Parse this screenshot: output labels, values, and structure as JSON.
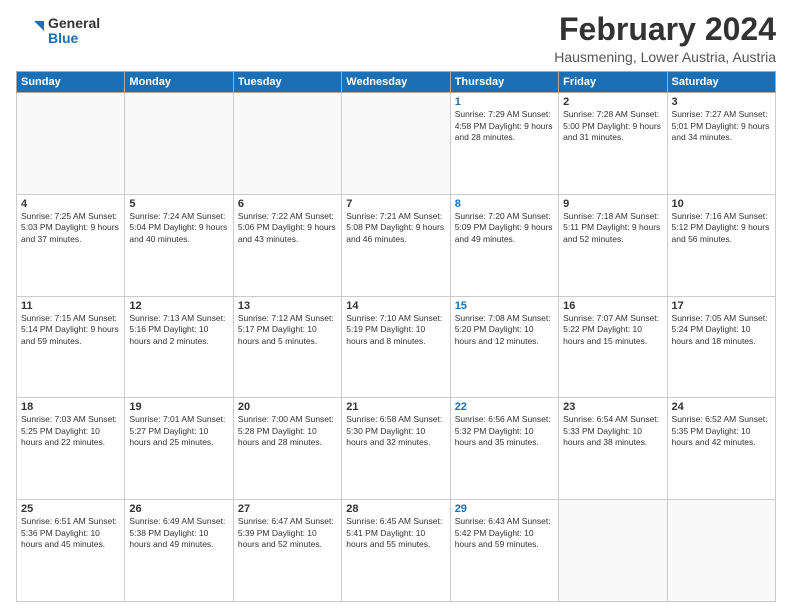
{
  "logo": {
    "general": "General",
    "blue": "Blue"
  },
  "header": {
    "month": "February 2024",
    "location": "Hausmening, Lower Austria, Austria"
  },
  "weekdays": [
    "Sunday",
    "Monday",
    "Tuesday",
    "Wednesday",
    "Thursday",
    "Friday",
    "Saturday"
  ],
  "weeks": [
    [
      {
        "day": "",
        "info": ""
      },
      {
        "day": "",
        "info": ""
      },
      {
        "day": "",
        "info": ""
      },
      {
        "day": "",
        "info": ""
      },
      {
        "day": "1",
        "info": "Sunrise: 7:29 AM\nSunset: 4:58 PM\nDaylight: 9 hours\nand 28 minutes."
      },
      {
        "day": "2",
        "info": "Sunrise: 7:28 AM\nSunset: 5:00 PM\nDaylight: 9 hours\nand 31 minutes."
      },
      {
        "day": "3",
        "info": "Sunrise: 7:27 AM\nSunset: 5:01 PM\nDaylight: 9 hours\nand 34 minutes."
      }
    ],
    [
      {
        "day": "4",
        "info": "Sunrise: 7:25 AM\nSunset: 5:03 PM\nDaylight: 9 hours\nand 37 minutes."
      },
      {
        "day": "5",
        "info": "Sunrise: 7:24 AM\nSunset: 5:04 PM\nDaylight: 9 hours\nand 40 minutes."
      },
      {
        "day": "6",
        "info": "Sunrise: 7:22 AM\nSunset: 5:06 PM\nDaylight: 9 hours\nand 43 minutes."
      },
      {
        "day": "7",
        "info": "Sunrise: 7:21 AM\nSunset: 5:08 PM\nDaylight: 9 hours\nand 46 minutes."
      },
      {
        "day": "8",
        "info": "Sunrise: 7:20 AM\nSunset: 5:09 PM\nDaylight: 9 hours\nand 49 minutes."
      },
      {
        "day": "9",
        "info": "Sunrise: 7:18 AM\nSunset: 5:11 PM\nDaylight: 9 hours\nand 52 minutes."
      },
      {
        "day": "10",
        "info": "Sunrise: 7:16 AM\nSunset: 5:12 PM\nDaylight: 9 hours\nand 56 minutes."
      }
    ],
    [
      {
        "day": "11",
        "info": "Sunrise: 7:15 AM\nSunset: 5:14 PM\nDaylight: 9 hours\nand 59 minutes."
      },
      {
        "day": "12",
        "info": "Sunrise: 7:13 AM\nSunset: 5:16 PM\nDaylight: 10 hours\nand 2 minutes."
      },
      {
        "day": "13",
        "info": "Sunrise: 7:12 AM\nSunset: 5:17 PM\nDaylight: 10 hours\nand 5 minutes."
      },
      {
        "day": "14",
        "info": "Sunrise: 7:10 AM\nSunset: 5:19 PM\nDaylight: 10 hours\nand 8 minutes."
      },
      {
        "day": "15",
        "info": "Sunrise: 7:08 AM\nSunset: 5:20 PM\nDaylight: 10 hours\nand 12 minutes."
      },
      {
        "day": "16",
        "info": "Sunrise: 7:07 AM\nSunset: 5:22 PM\nDaylight: 10 hours\nand 15 minutes."
      },
      {
        "day": "17",
        "info": "Sunrise: 7:05 AM\nSunset: 5:24 PM\nDaylight: 10 hours\nand 18 minutes."
      }
    ],
    [
      {
        "day": "18",
        "info": "Sunrise: 7:03 AM\nSunset: 5:25 PM\nDaylight: 10 hours\nand 22 minutes."
      },
      {
        "day": "19",
        "info": "Sunrise: 7:01 AM\nSunset: 5:27 PM\nDaylight: 10 hours\nand 25 minutes."
      },
      {
        "day": "20",
        "info": "Sunrise: 7:00 AM\nSunset: 5:28 PM\nDaylight: 10 hours\nand 28 minutes."
      },
      {
        "day": "21",
        "info": "Sunrise: 6:58 AM\nSunset: 5:30 PM\nDaylight: 10 hours\nand 32 minutes."
      },
      {
        "day": "22",
        "info": "Sunrise: 6:56 AM\nSunset: 5:32 PM\nDaylight: 10 hours\nand 35 minutes."
      },
      {
        "day": "23",
        "info": "Sunrise: 6:54 AM\nSunset: 5:33 PM\nDaylight: 10 hours\nand 38 minutes."
      },
      {
        "day": "24",
        "info": "Sunrise: 6:52 AM\nSunset: 5:35 PM\nDaylight: 10 hours\nand 42 minutes."
      }
    ],
    [
      {
        "day": "25",
        "info": "Sunrise: 6:51 AM\nSunset: 5:36 PM\nDaylight: 10 hours\nand 45 minutes."
      },
      {
        "day": "26",
        "info": "Sunrise: 6:49 AM\nSunset: 5:38 PM\nDaylight: 10 hours\nand 49 minutes."
      },
      {
        "day": "27",
        "info": "Sunrise: 6:47 AM\nSunset: 5:39 PM\nDaylight: 10 hours\nand 52 minutes."
      },
      {
        "day": "28",
        "info": "Sunrise: 6:45 AM\nSunset: 5:41 PM\nDaylight: 10 hours\nand 55 minutes."
      },
      {
        "day": "29",
        "info": "Sunrise: 6:43 AM\nSunset: 5:42 PM\nDaylight: 10 hours\nand 59 minutes."
      },
      {
        "day": "",
        "info": ""
      },
      {
        "day": "",
        "info": ""
      }
    ]
  ]
}
